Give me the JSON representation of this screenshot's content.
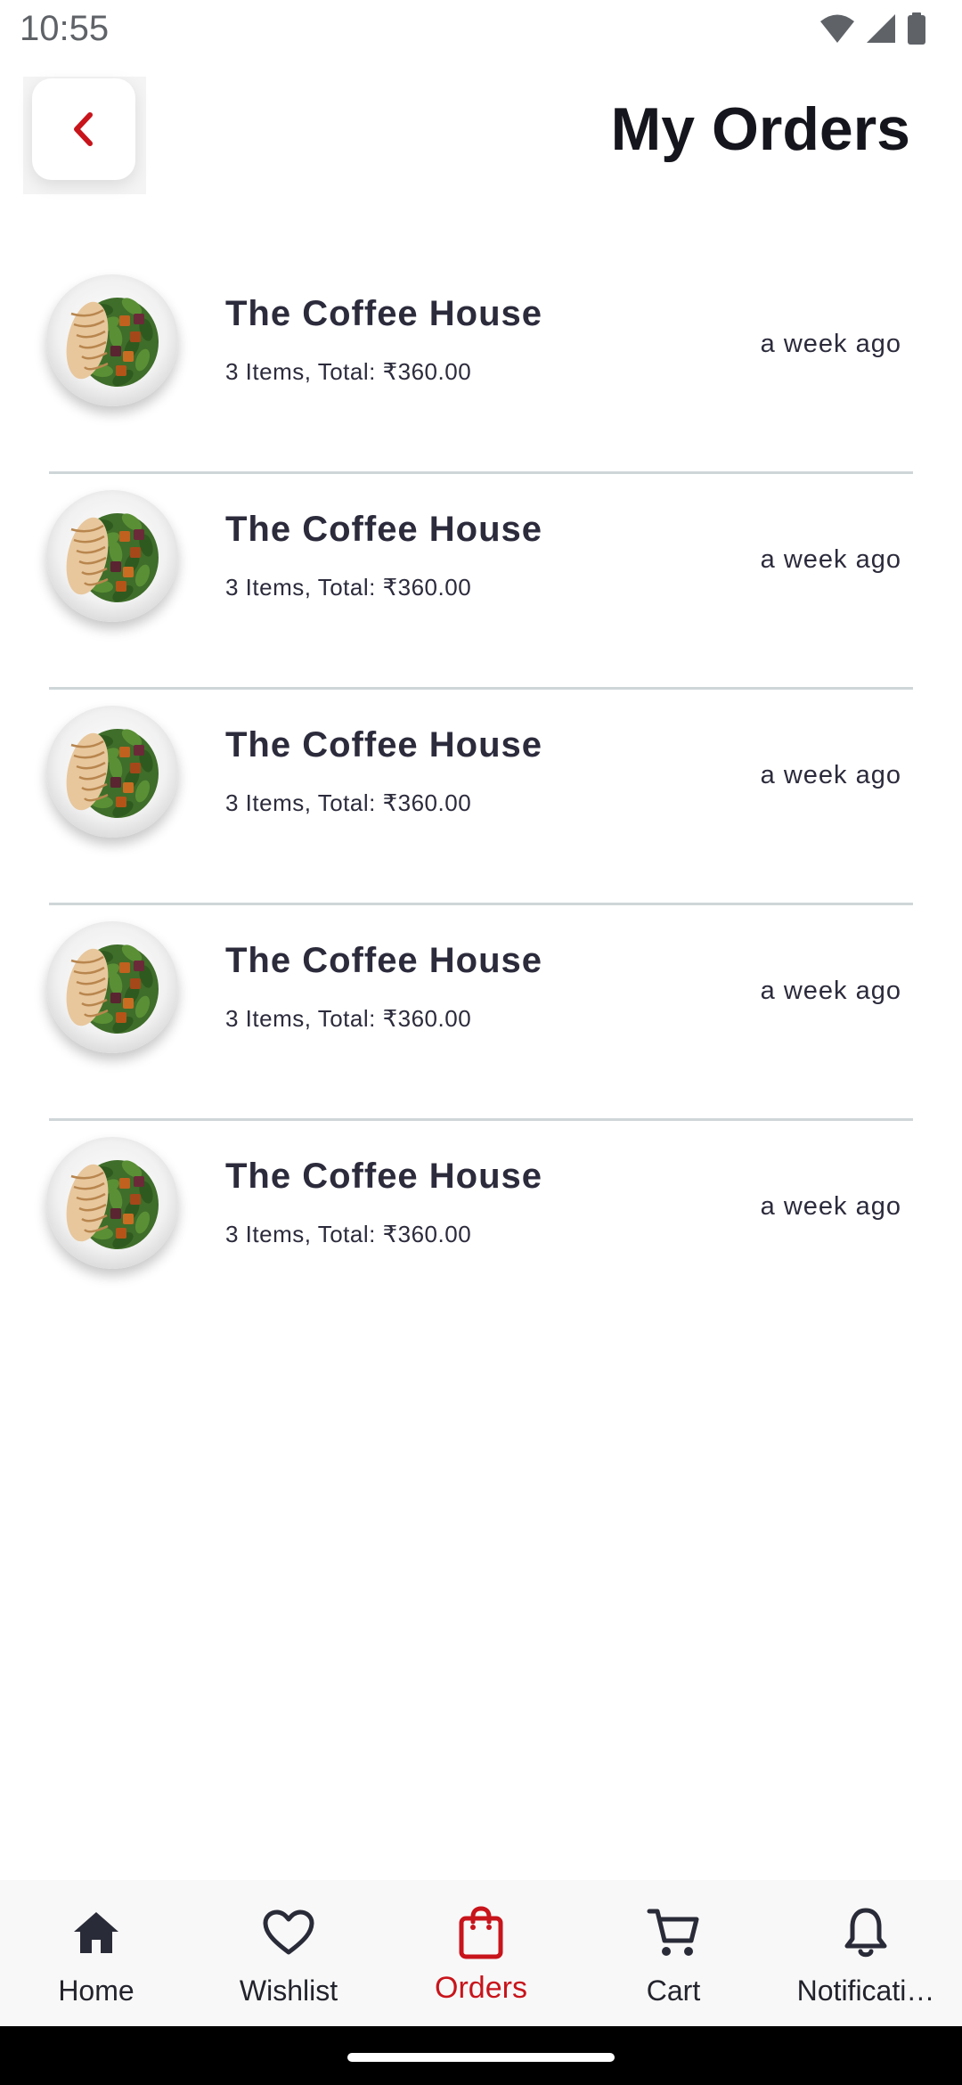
{
  "status_bar": {
    "time": "10:55",
    "icons": [
      "wifi-icon",
      "cellular-signal-icon",
      "battery-icon"
    ]
  },
  "header": {
    "back_icon": "chevron-left-icon",
    "title": "My Orders"
  },
  "orders": [
    {
      "restaurant": "The Coffee House",
      "summary": "3 Items, Total: ₹360.00",
      "time_ago": "a week ago"
    },
    {
      "restaurant": "The Coffee House",
      "summary": "3 Items, Total: ₹360.00",
      "time_ago": "a week ago"
    },
    {
      "restaurant": "The Coffee House",
      "summary": "3 Items, Total: ₹360.00",
      "time_ago": "a week ago"
    },
    {
      "restaurant": "The Coffee House",
      "summary": "3 Items, Total: ₹360.00",
      "time_ago": "a week ago"
    },
    {
      "restaurant": "The Coffee House",
      "summary": "3 Items, Total: ₹360.00",
      "time_ago": "a week ago"
    }
  ],
  "bottom_nav": {
    "items": [
      {
        "label": "Home",
        "icon": "home-icon"
      },
      {
        "label": "Wishlist",
        "icon": "heart-icon"
      },
      {
        "label": "Orders",
        "icon": "shopping-bag-icon",
        "active": true
      },
      {
        "label": "Cart",
        "icon": "cart-icon"
      },
      {
        "label": "Notificati…",
        "icon": "bell-icon"
      }
    ]
  },
  "colors": {
    "accent": "#c8141b",
    "text_dark": "#2c2b3c",
    "title": "#15151d",
    "divider": "#cfd6d8",
    "nav_background": "#f8f8f8"
  }
}
